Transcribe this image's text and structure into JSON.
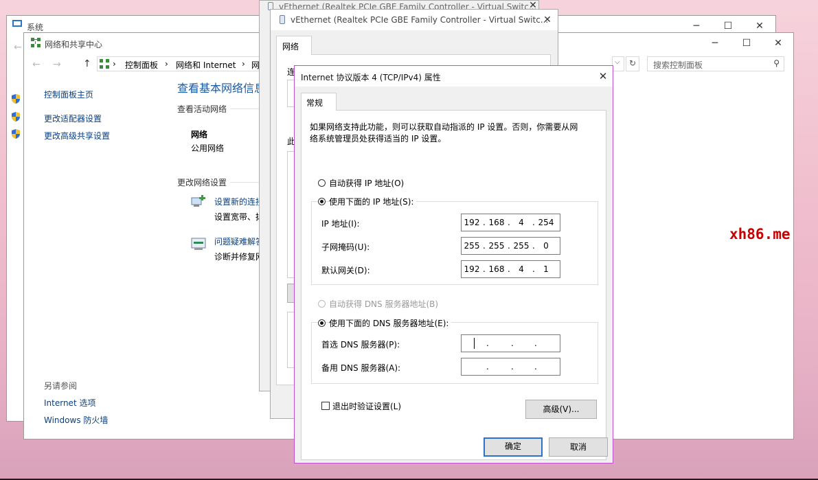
{
  "system_window": {
    "title": "系统"
  },
  "nsc": {
    "title": "网络和共享中心",
    "breadcrumb": [
      "控制面板",
      "网络和 Internet",
      "网"
    ],
    "search_placeholder": "搜索控制面板",
    "sidebar": {
      "home": "控制面板主页",
      "links": [
        "更改适配器设置",
        "更改高级共享设置"
      ],
      "see_also_heading": "另请参阅",
      "see_also": [
        "Internet 选项",
        "Windows 防火墙"
      ]
    },
    "main": {
      "heading": "查看基本网络信息",
      "active_networks": "查看活动网络",
      "network_name": "网络",
      "network_type": "公用网络",
      "change_settings": "更改网络设置",
      "task1_title": "设置新的连接",
      "task1_desc": "设置宽带、拨",
      "task2_title": "问题疑难解答",
      "task2_desc": "诊断并修复网"
    }
  },
  "veth_back": {
    "title": "vEthernet (Realtek PCIe GBE Family Controller - Virtual Switc..."
  },
  "veth_front": {
    "title": "vEthernet (Realtek PCIe GBE Family Controller - Virtual Switc...",
    "tab": "网络",
    "conn_label": "连",
    "items_label": "此"
  },
  "ipv4": {
    "title": "Internet 协议版本 4 (TCP/IPv4) 属性",
    "tab": "常规",
    "description": "如果网络支持此功能，则可以获取自动指派的 IP 设置。否则，你需要从网络系统管理员处获得适当的 IP 设置。",
    "auto_ip": "自动获得 IP 地址(O)",
    "use_ip": "使用下面的 IP 地址(S):",
    "ip_label": "IP 地址(I):",
    "ip": [
      "192",
      "168",
      "4",
      "254"
    ],
    "mask_label": "子网掩码(U):",
    "mask": [
      "255",
      "255",
      "255",
      "0"
    ],
    "gateway_label": "默认网关(D):",
    "gateway": [
      "192",
      "168",
      "4",
      "1"
    ],
    "auto_dns": "自动获得 DNS 服务器地址(B)",
    "use_dns": "使用下面的 DNS 服务器地址(E):",
    "dns1_label": "首选 DNS 服务器(P):",
    "dns2_label": "备用 DNS 服务器(A):",
    "validate": "退出时验证设置(L)",
    "advanced": "高级(V)...",
    "ok": "确定",
    "cancel": "取消",
    "selected_ip_mode": "manual",
    "selected_dns_mode": "manual",
    "validate_checked": false
  },
  "watermark": "xh86.me",
  "colors": {
    "link": "#0b3f7f",
    "heading": "#1a5aa6",
    "dialog_border": "#c04fd0",
    "watermark": "#c80000"
  }
}
